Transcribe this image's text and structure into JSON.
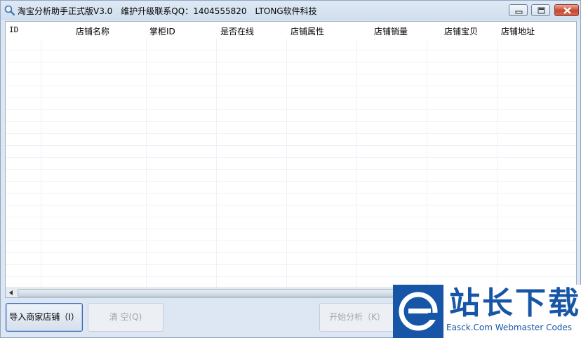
{
  "window": {
    "title": "淘宝分析助手正式版V3.0",
    "title_contact": "维护升级联系QQ：1404555820",
    "title_company": "LTONG软件科技"
  },
  "grid": {
    "columns": [
      "ID",
      "店铺名称",
      "掌柜ID",
      "是否在线",
      "店铺属性",
      "店铺销量",
      "店铺宝贝",
      "店铺地址"
    ]
  },
  "buttons": {
    "import": "导入商家店铺（I）",
    "clear": "清 空(Q)",
    "start": "开始分析（K）"
  },
  "watermark": {
    "brand": "站长下载",
    "tagline": "Easck.Com Webmaster Codes"
  },
  "colors": {
    "accent": "#1756a6",
    "close_button": "#c9462f"
  }
}
